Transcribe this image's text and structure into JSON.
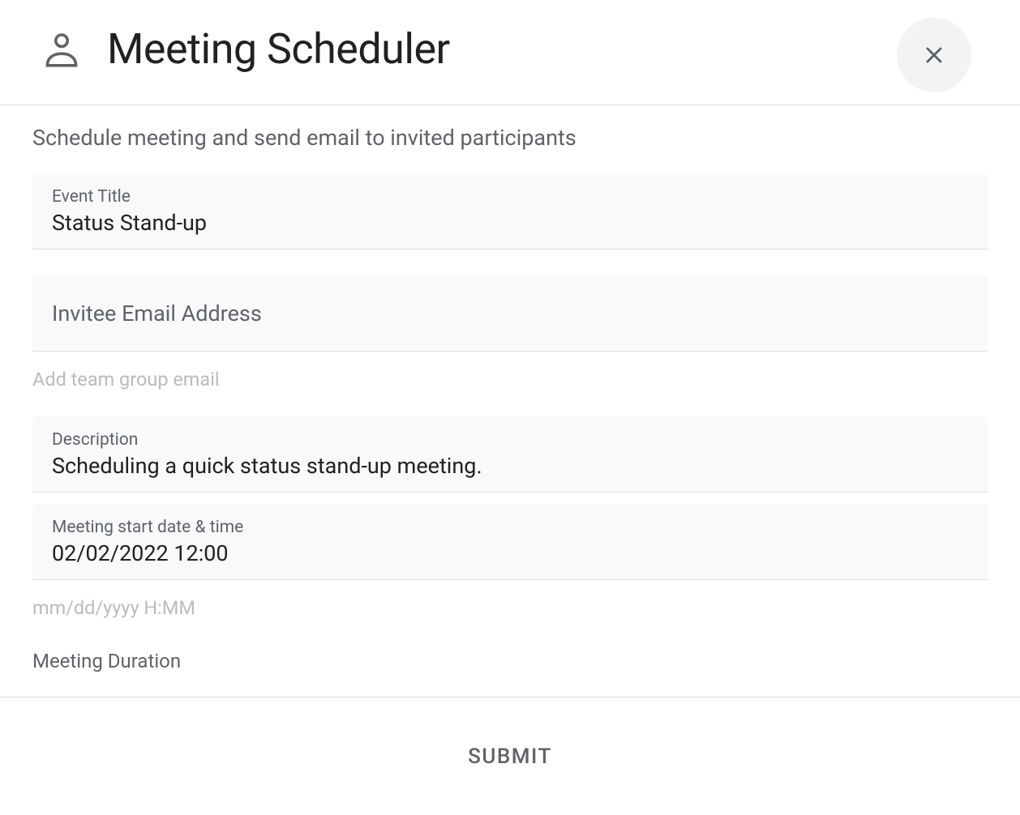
{
  "header": {
    "title": "Meeting Scheduler"
  },
  "subtitle": "Schedule meeting and send email to invited participants",
  "fields": {
    "event_title": {
      "label": "Event Title",
      "value": "Status Stand-up"
    },
    "invitee_email": {
      "label": "Invitee Email Address",
      "value": "",
      "helper": "Add team group email"
    },
    "description": {
      "label": "Description",
      "value": "Scheduling a quick status stand-up meeting."
    },
    "start_datetime": {
      "label": "Meeting start date & time",
      "value": "02/02/2022 12:00",
      "helper": "mm/dd/yyyy H:MM"
    },
    "duration": {
      "label": "Meeting Duration"
    }
  },
  "footer": {
    "submit_label": "SUBMIT"
  }
}
